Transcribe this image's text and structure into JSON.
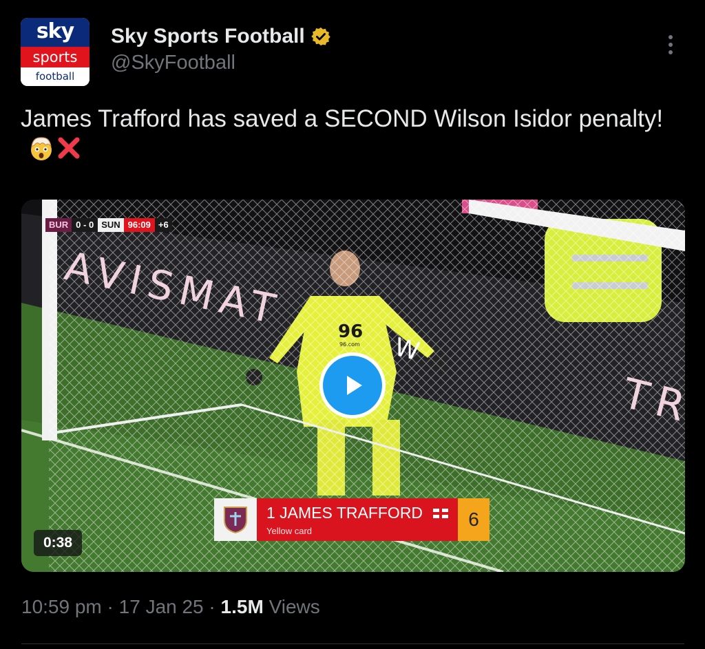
{
  "account": {
    "avatar": {
      "line1": "sky",
      "line2": "sports",
      "line3": "football"
    },
    "display_name": "Sky Sports Football",
    "handle": "@SkyFootball",
    "verified_color": "#e8b829"
  },
  "tweet": {
    "text_main": "James Trafford has saved a SECOND Wilson Isidor penalty!",
    "emojis": [
      "exploding-head-emoji",
      "cross-mark-emoji"
    ]
  },
  "video": {
    "scorebug": {
      "home": "BUR",
      "score": "0 - 0",
      "away": "SUN",
      "clock": "96:09",
      "added": "+6"
    },
    "background_text": {
      "ad_left": "AVISMAT",
      "ad_right": "TR",
      "ad_mid": "W"
    },
    "shirt_number": "96",
    "shirt_sponsor": "96.com",
    "caption": {
      "name": "1 JAMES TRAFFORD",
      "subtitle": "Yellow card",
      "number": "6"
    },
    "duration": "0:38"
  },
  "meta": {
    "time": "10:59 pm",
    "separator": "·",
    "date": "17 Jan 25",
    "views_count": "1.5M",
    "views_label": "Views"
  },
  "colors": {
    "accent": "#1d9bf0",
    "text": "#e7e9ea",
    "muted": "#71767b",
    "background": "#000000"
  }
}
